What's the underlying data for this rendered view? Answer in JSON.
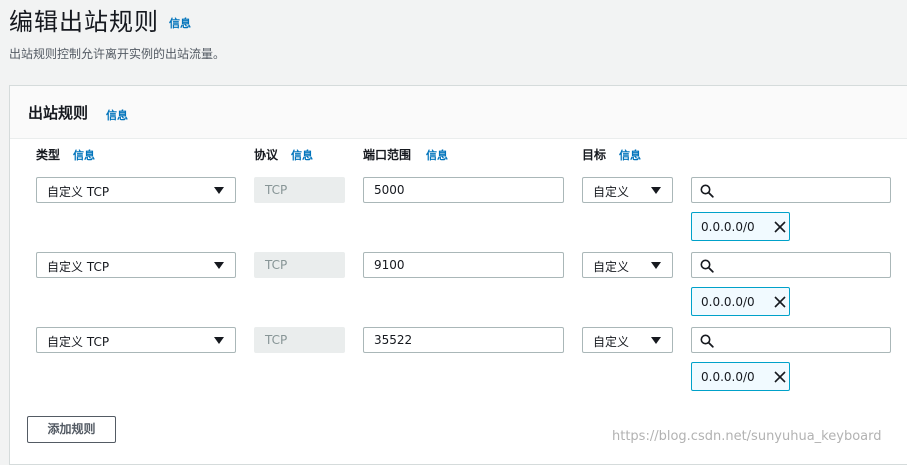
{
  "header": {
    "title": "编辑出站规则",
    "info": "信息",
    "description": "出站规则控制允许离开实例的出站流量。"
  },
  "panel": {
    "title": "出站规则",
    "info": "信息"
  },
  "columns": {
    "type": "类型",
    "protocol": "协议",
    "port_range": "端口范围",
    "destination": "目标",
    "info": "信息"
  },
  "rules": [
    {
      "type": "自定义 TCP",
      "protocol": "TCP",
      "port": "5000",
      "destination": "自定义",
      "search": "",
      "cidr": "0.0.0.0/0"
    },
    {
      "type": "自定义 TCP",
      "protocol": "TCP",
      "port": "9100",
      "destination": "自定义",
      "search": "",
      "cidr": "0.0.0.0/0"
    },
    {
      "type": "自定义 TCP",
      "protocol": "TCP",
      "port": "35522",
      "destination": "自定义",
      "search": "",
      "cidr": "0.0.0.0/0"
    }
  ],
  "add_rule_label": "添加规则",
  "watermark": "https://blog.csdn.net/sunyuhua_keyboard",
  "icons": {
    "search": "search-icon",
    "remove": "close-icon",
    "dropdown": "caret-down-icon"
  },
  "colors": {
    "link": "#0073bb",
    "token_border": "#00a1c9",
    "token_bg": "#f1faff"
  }
}
